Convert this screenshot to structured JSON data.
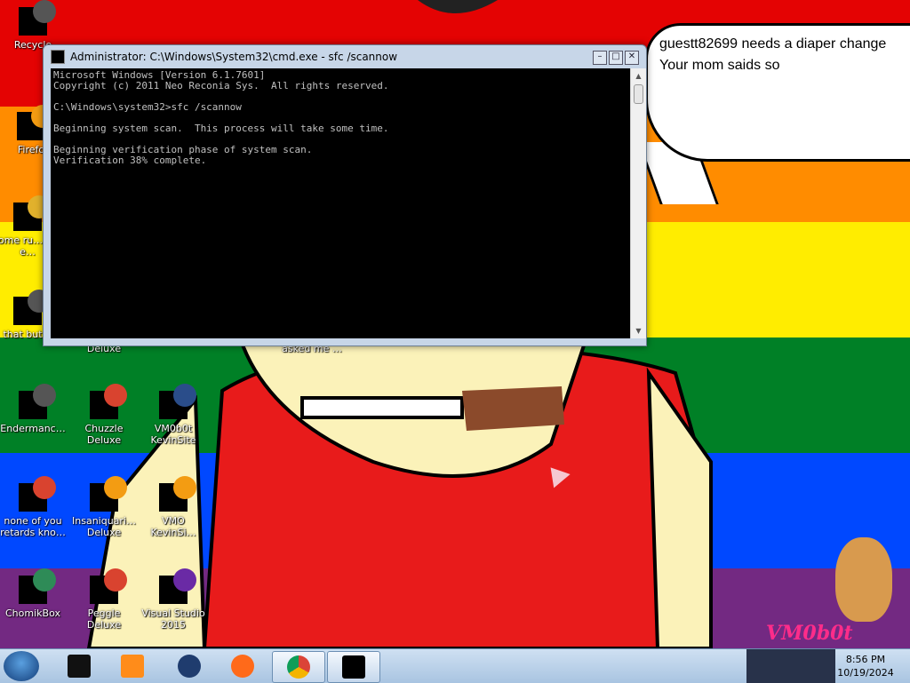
{
  "desktop": {
    "icons": [
      {
        "label": "Recycle",
        "x": 0
      },
      {
        "label": "Firefo",
        "x": 0
      },
      {
        "label": "some ru… ran e…",
        "x": 0
      },
      {
        "label": "that but…",
        "x": 0
      },
      {
        "label": "Deluxe",
        "x": 0
      },
      {
        "label": "asked me …",
        "x": 0
      },
      {
        "label": "Endermanc…",
        "x": 0
      },
      {
        "label": "Chuzzle Deluxe",
        "x": 0
      },
      {
        "label": "VM0b0t KevinSite",
        "x": 0
      },
      {
        "label": "none of you retards kno…",
        "x": 0
      },
      {
        "label": "Insaniquari… Deluxe",
        "x": 0
      },
      {
        "label": "VMO KevinSi…",
        "x": 0
      },
      {
        "label": "ChomikBox",
        "x": 0
      },
      {
        "label": "Peggle Deluxe",
        "x": 0
      },
      {
        "label": "Visual Studio 2015",
        "x": 0
      }
    ]
  },
  "cmd": {
    "title": "Administrator: C:\\Windows\\System32\\cmd.exe - sfc  /scannow",
    "console": "Microsoft Windows [Version 6.1.7601]\nCopyright (c) 2011 Neo Reconia Sys.  All rights reserved.\n\nC:\\Windows\\system32>sfc /scannow\n\nBeginning system scan.  This process will take some time.\n\nBeginning verification phase of system scan.\nVerification 38% complete.",
    "progress_percent": 38
  },
  "bubble": {
    "line1": "guestt82699 needs a diaper change",
    "line2": "Your mom saids so"
  },
  "watermark": "VM0b0t",
  "taskbar": {
    "time": "8:56 PM",
    "date": "10/19/2024"
  },
  "colors": {
    "flag": [
      "#e40303",
      "#ff8c00",
      "#ffed00",
      "#008026",
      "#0048ff",
      "#732982"
    ],
    "taskbar": "#b9d1ea",
    "console_bg": "#000000",
    "console_fg": "#c0c0c0"
  }
}
